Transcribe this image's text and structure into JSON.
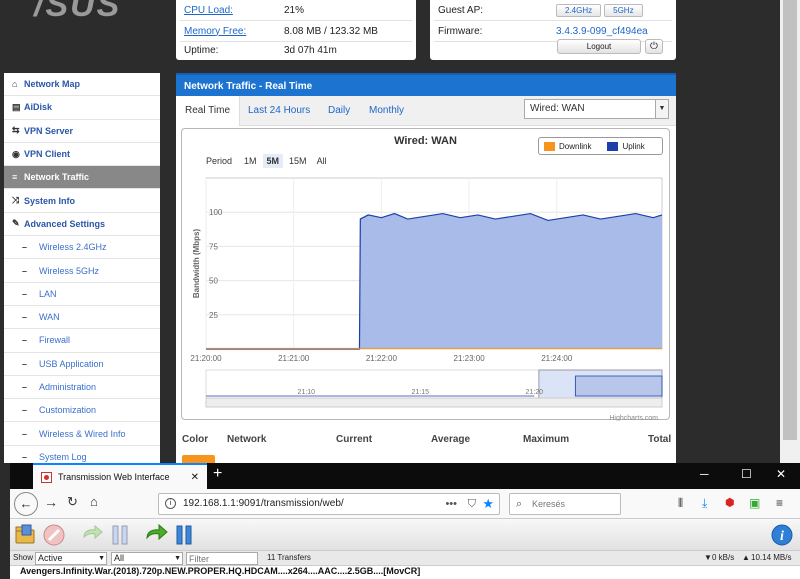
{
  "router": {
    "logo": "/SUS",
    "sysinfo": [
      {
        "label": "CPU Load:",
        "value": "21%"
      },
      {
        "label": "Memory Free:",
        "value": "8.08 MB / 123.32 MB"
      },
      {
        "label": "Uptime:",
        "value": "3d 07h 41m"
      }
    ],
    "status": {
      "guest_label": "Guest AP:",
      "guest_24": "2.4GHz",
      "guest_5": "5GHz",
      "fw_label": "Firmware:",
      "fw_value": "3.4.3.9-099_cf494ea",
      "logout": "Logout"
    },
    "nav": [
      {
        "label": "Network Map",
        "icon": "home-icon",
        "glyph": "⌂"
      },
      {
        "label": "AiDisk",
        "icon": "disk-icon",
        "glyph": "▤"
      },
      {
        "label": "VPN Server",
        "icon": "vpn-server-icon",
        "glyph": "⇆"
      },
      {
        "label": "VPN Client",
        "icon": "globe-icon",
        "glyph": "◉"
      },
      {
        "label": "Network Traffic",
        "icon": "list-icon",
        "glyph": "≡",
        "active": true
      },
      {
        "label": "System Info",
        "icon": "shuffle-icon",
        "glyph": "⤨"
      },
      {
        "label": "Advanced Settings",
        "icon": "wrench-icon",
        "glyph": "✎"
      },
      {
        "label": "Wireless 2.4GHz",
        "sub": true
      },
      {
        "label": "Wireless 5GHz",
        "sub": true
      },
      {
        "label": "LAN",
        "sub": true
      },
      {
        "label": "WAN",
        "sub": true
      },
      {
        "label": "Firewall",
        "sub": true
      },
      {
        "label": "USB Application",
        "sub": true
      },
      {
        "label": "Administration",
        "sub": true
      },
      {
        "label": "Customization",
        "sub": true
      },
      {
        "label": "Wireless & Wired Info",
        "sub": true
      },
      {
        "label": "System Log",
        "sub": true
      }
    ],
    "content": {
      "title": "Network Traffic - Real Time",
      "tabs": [
        "Real Time",
        "Last 24 Hours",
        "Daily",
        "Monthly"
      ],
      "interface_select": "Wired: WAN",
      "table_headers": [
        "Color",
        "Network",
        "Current",
        "Average",
        "Maximum",
        "Total"
      ]
    }
  },
  "chart_data": {
    "type": "area",
    "title": "Wired: WAN",
    "ylabel": "Bandwidth (Mbps)",
    "ylim": [
      0,
      125
    ],
    "yticks": [
      25,
      50,
      75,
      100
    ],
    "xticks": [
      "21:20:00",
      "21:21:00",
      "21:22:00",
      "21:23:00",
      "21:24:00"
    ],
    "period_label": "Period",
    "periods": [
      "1M",
      "5M",
      "15M",
      "All"
    ],
    "selected_period": "5M",
    "legend": [
      "Downlink",
      "Uplink"
    ],
    "colors": {
      "downlink": "#f7941d",
      "uplink": "#1c3faa",
      "uplink_fill": "#a9bbe8"
    },
    "grid": true,
    "legend_position": "top-right",
    "credit": "Highcharts.com",
    "navigator_ticks": [
      "21:10",
      "21:15",
      "21:20"
    ],
    "series": [
      {
        "name": "Downlink",
        "x_minutes": [
          0,
          5.2
        ],
        "values": [
          0.5,
          0.5
        ]
      },
      {
        "name": "Uplink",
        "x_minutes": [
          0,
          1.75,
          1.76,
          1.85,
          2.0,
          2.15,
          2.3,
          2.5,
          2.7,
          2.9,
          3.1,
          3.3,
          3.5,
          3.7,
          3.9,
          4.1,
          4.3,
          4.5,
          4.7,
          4.9,
          5.1,
          5.2
        ],
        "values": [
          0,
          0,
          95,
          98,
          96,
          99,
          95,
          97,
          99,
          96,
          98,
          95,
          97,
          99,
          94,
          96,
          98,
          95,
          97,
          99,
          96,
          98
        ]
      }
    ]
  },
  "firefox": {
    "tab_title": "Transmission Web Interface",
    "url": "192.168.1.1:9091/transmission/web/",
    "search_placeholder": "Keresés"
  },
  "transmission": {
    "show_label": "Show",
    "filter_state": "Active",
    "filter_tracker": "All",
    "filter_placeholder": "Filter",
    "transfers": "11 Transfers",
    "down_speed": "0 kB/s",
    "up_speed": "10.14 MB/s",
    "torrent_name": "Avengers.Infinity.War.(2018).720p.NEW.PROPER.HQ.HDCAM....x264....AAC....2.5GB....[MovCR]"
  }
}
